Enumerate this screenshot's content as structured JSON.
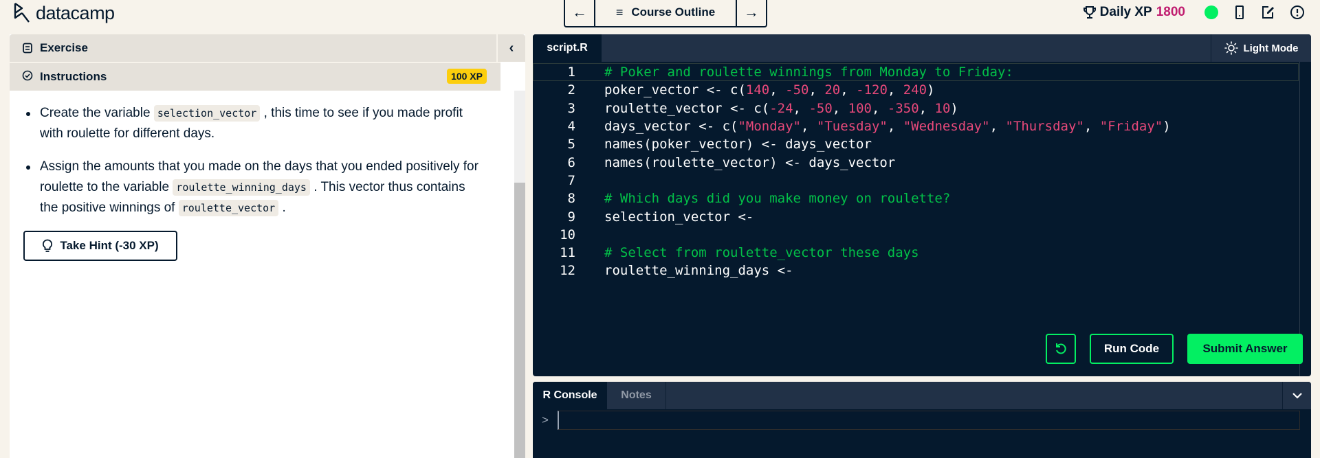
{
  "header": {
    "logo_text": "datacamp",
    "nav": {
      "prev_label": "←",
      "outline_label": "Course Outline",
      "next_label": "→"
    },
    "daily_xp_label": "Daily XP",
    "daily_xp_value": "1800",
    "status_color": "#03ef62",
    "icons": [
      "mobile-icon",
      "edit-icon",
      "alert-icon"
    ]
  },
  "left_panel": {
    "exercise_label": "Exercise",
    "collapse_label": "‹",
    "instructions_label": "Instructions",
    "xp_badge": "100 XP",
    "instructions": [
      {
        "parts": [
          {
            "t": "Create the variable "
          },
          {
            "c": "selection_vector"
          },
          {
            "t": " , this time to see if you made profit with roulette for different days."
          }
        ]
      },
      {
        "parts": [
          {
            "t": "Assign the amounts that you made on the days that you ended positively for roulette to the variable "
          },
          {
            "c": "roulette_winning_days"
          },
          {
            "t": " . This vector thus contains the positive winnings of "
          },
          {
            "c": "roulette_vector"
          },
          {
            "t": " ."
          }
        ]
      }
    ],
    "hint_button": "Take Hint (-30 XP)"
  },
  "editor": {
    "tab_label": "script.R",
    "light_mode_label": "Light Mode",
    "lines": [
      [
        {
          "k": "cm",
          "v": "# Poker and roulette winnings from Monday to Friday:"
        }
      ],
      [
        {
          "k": "",
          "v": "poker_vector <- c("
        },
        {
          "k": "num",
          "v": "140"
        },
        {
          "k": "",
          "v": ", "
        },
        {
          "k": "num",
          "v": "-50"
        },
        {
          "k": "",
          "v": ", "
        },
        {
          "k": "num",
          "v": "20"
        },
        {
          "k": "",
          "v": ", "
        },
        {
          "k": "num",
          "v": "-120"
        },
        {
          "k": "",
          "v": ", "
        },
        {
          "k": "num",
          "v": "240"
        },
        {
          "k": "",
          "v": ")"
        }
      ],
      [
        {
          "k": "",
          "v": "roulette_vector <- c("
        },
        {
          "k": "num",
          "v": "-24"
        },
        {
          "k": "",
          "v": ", "
        },
        {
          "k": "num",
          "v": "-50"
        },
        {
          "k": "",
          "v": ", "
        },
        {
          "k": "num",
          "v": "100"
        },
        {
          "k": "",
          "v": ", "
        },
        {
          "k": "num",
          "v": "-350"
        },
        {
          "k": "",
          "v": ", "
        },
        {
          "k": "num",
          "v": "10"
        },
        {
          "k": "",
          "v": ")"
        }
      ],
      [
        {
          "k": "",
          "v": "days_vector <- c("
        },
        {
          "k": "str",
          "v": "\"Monday\""
        },
        {
          "k": "",
          "v": ", "
        },
        {
          "k": "str",
          "v": "\"Tuesday\""
        },
        {
          "k": "",
          "v": ", "
        },
        {
          "k": "str",
          "v": "\"Wednesday\""
        },
        {
          "k": "",
          "v": ", "
        },
        {
          "k": "str",
          "v": "\"Thursday\""
        },
        {
          "k": "",
          "v": ", "
        },
        {
          "k": "str",
          "v": "\"Friday\""
        },
        {
          "k": "",
          "v": ")"
        }
      ],
      [
        {
          "k": "",
          "v": "names(poker_vector) <- days_vector"
        }
      ],
      [
        {
          "k": "",
          "v": "names(roulette_vector) <- days_vector"
        }
      ],
      [],
      [
        {
          "k": "cm",
          "v": "# Which days did you make money on roulette?"
        }
      ],
      [
        {
          "k": "",
          "v": "selection_vector <-"
        }
      ],
      [],
      [
        {
          "k": "cm",
          "v": "# Select from roulette_vector these days"
        }
      ],
      [
        {
          "k": "",
          "v": "roulette_winning_days <-"
        }
      ]
    ],
    "run_label": "Run Code",
    "submit_label": "Submit Answer"
  },
  "console": {
    "tabs": [
      "R Console",
      "Notes"
    ],
    "prompt": ">",
    "input_value": ""
  },
  "colors": {
    "accent_green": "#03ef62",
    "xp_pink": "#c01c6f",
    "badge_yellow": "#fcce0d",
    "navy": "#05192d"
  }
}
